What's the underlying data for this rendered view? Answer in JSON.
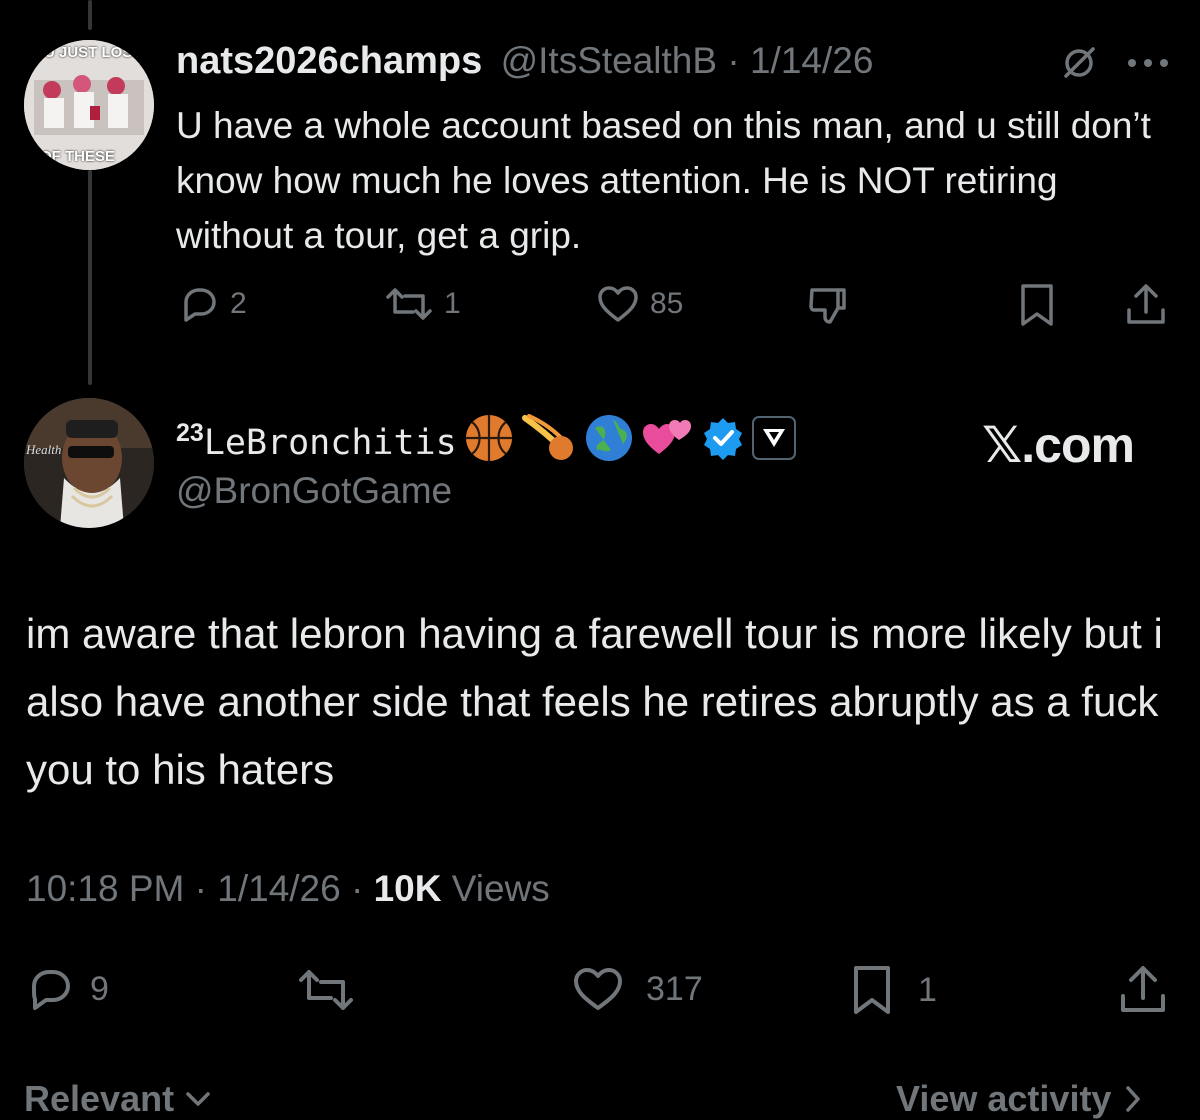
{
  "reply": {
    "avatar_text_top": "U JUST LOST",
    "avatar_text_bottom": "OF THESE",
    "display_name": "nats2026champs",
    "handle": "@ItsStealthB",
    "separator": "·",
    "date": "1/14/26",
    "text": "U have a whole account based on this man, and u still don’t know how much he loves attention. He is NOT retiring without a tour, get a grip.",
    "counts": {
      "replies": "2",
      "reposts": "1",
      "likes": "85"
    }
  },
  "main": {
    "name_prefix": "23",
    "display_name": "LeBronchitis",
    "handle": "@BronGotGame",
    "brand": "𝕏.com",
    "avatar_label": "Health",
    "text": "im aware that lebron having a farewell tour is more likely but i also have another side that feels he retires abruptly as a fuck you to his haters",
    "time": "10:18 PM",
    "separator": "·",
    "date": "1/14/26",
    "views_count": "10K",
    "views_label": "Views",
    "counts": {
      "replies": "9",
      "likes": "317",
      "bookmarks": "1"
    }
  },
  "footer": {
    "left_label": "Relevant",
    "right_label": "View activity"
  },
  "colors": {
    "background": "#000000",
    "text": "#e7e9ea",
    "muted": "#71767b",
    "verified": "#1d9bf0",
    "thread_line": "#333639"
  },
  "icons": [
    "reply-icon",
    "repost-icon",
    "like-icon",
    "downvote-icon",
    "bookmark-icon",
    "share-icon",
    "grok-icon",
    "more-icon",
    "verified-badge-icon",
    "basketball-emoji",
    "globe-emoji",
    "hearts-emoji",
    "chevron-down-icon",
    "chevron-right-icon"
  ]
}
